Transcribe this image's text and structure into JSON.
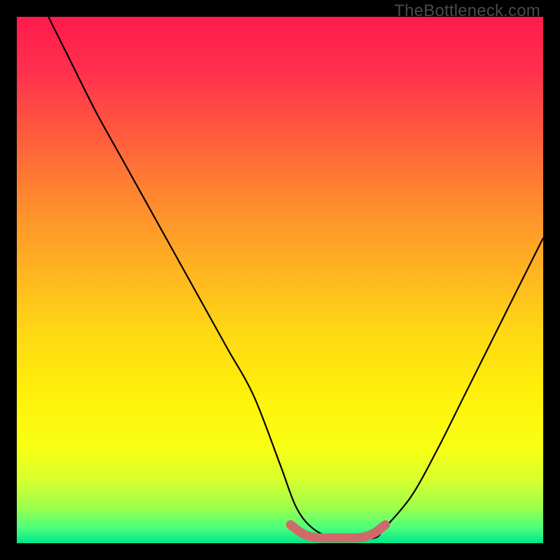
{
  "watermark": "TheBottleneck.com",
  "gradient_stops": [
    {
      "offset": 0.0,
      "color": "#ff1a4b"
    },
    {
      "offset": 0.1,
      "color": "#ff2f4e"
    },
    {
      "offset": 0.22,
      "color": "#ff5a3e"
    },
    {
      "offset": 0.35,
      "color": "#ff8a2e"
    },
    {
      "offset": 0.48,
      "color": "#ffb321"
    },
    {
      "offset": 0.6,
      "color": "#ffd814"
    },
    {
      "offset": 0.72,
      "color": "#fff10a"
    },
    {
      "offset": 0.82,
      "color": "#f8ff14"
    },
    {
      "offset": 0.88,
      "color": "#d6ff2e"
    },
    {
      "offset": 0.93,
      "color": "#a0ff4a"
    },
    {
      "offset": 0.97,
      "color": "#4dff7a"
    },
    {
      "offset": 1.0,
      "color": "#00e68a"
    }
  ],
  "chart_data": {
    "type": "line",
    "title": "",
    "xlabel": "",
    "ylabel": "",
    "xlim": [
      0,
      100
    ],
    "ylim": [
      0,
      100
    ],
    "series": [
      {
        "name": "curve",
        "x": [
          6,
          10,
          15,
          20,
          25,
          30,
          35,
          40,
          45,
          50,
          53,
          56,
          60,
          64,
          68,
          70,
          75,
          80,
          85,
          90,
          95,
          100
        ],
        "y": [
          100,
          92,
          82,
          73,
          64,
          55,
          46,
          37,
          28,
          15,
          7,
          3,
          1,
          1,
          1,
          3,
          9,
          18,
          28,
          38,
          48,
          58
        ]
      },
      {
        "name": "marker-band",
        "x": [
          52,
          54,
          56,
          58,
          60,
          62,
          64,
          66,
          68,
          70
        ],
        "y": [
          3.5,
          2.0,
          1.2,
          1.0,
          1.0,
          1.0,
          1.0,
          1.2,
          2.0,
          3.5
        ]
      }
    ],
    "annotations": [],
    "colors": {
      "curve": "#000000",
      "marker": "#d06a6a"
    }
  }
}
